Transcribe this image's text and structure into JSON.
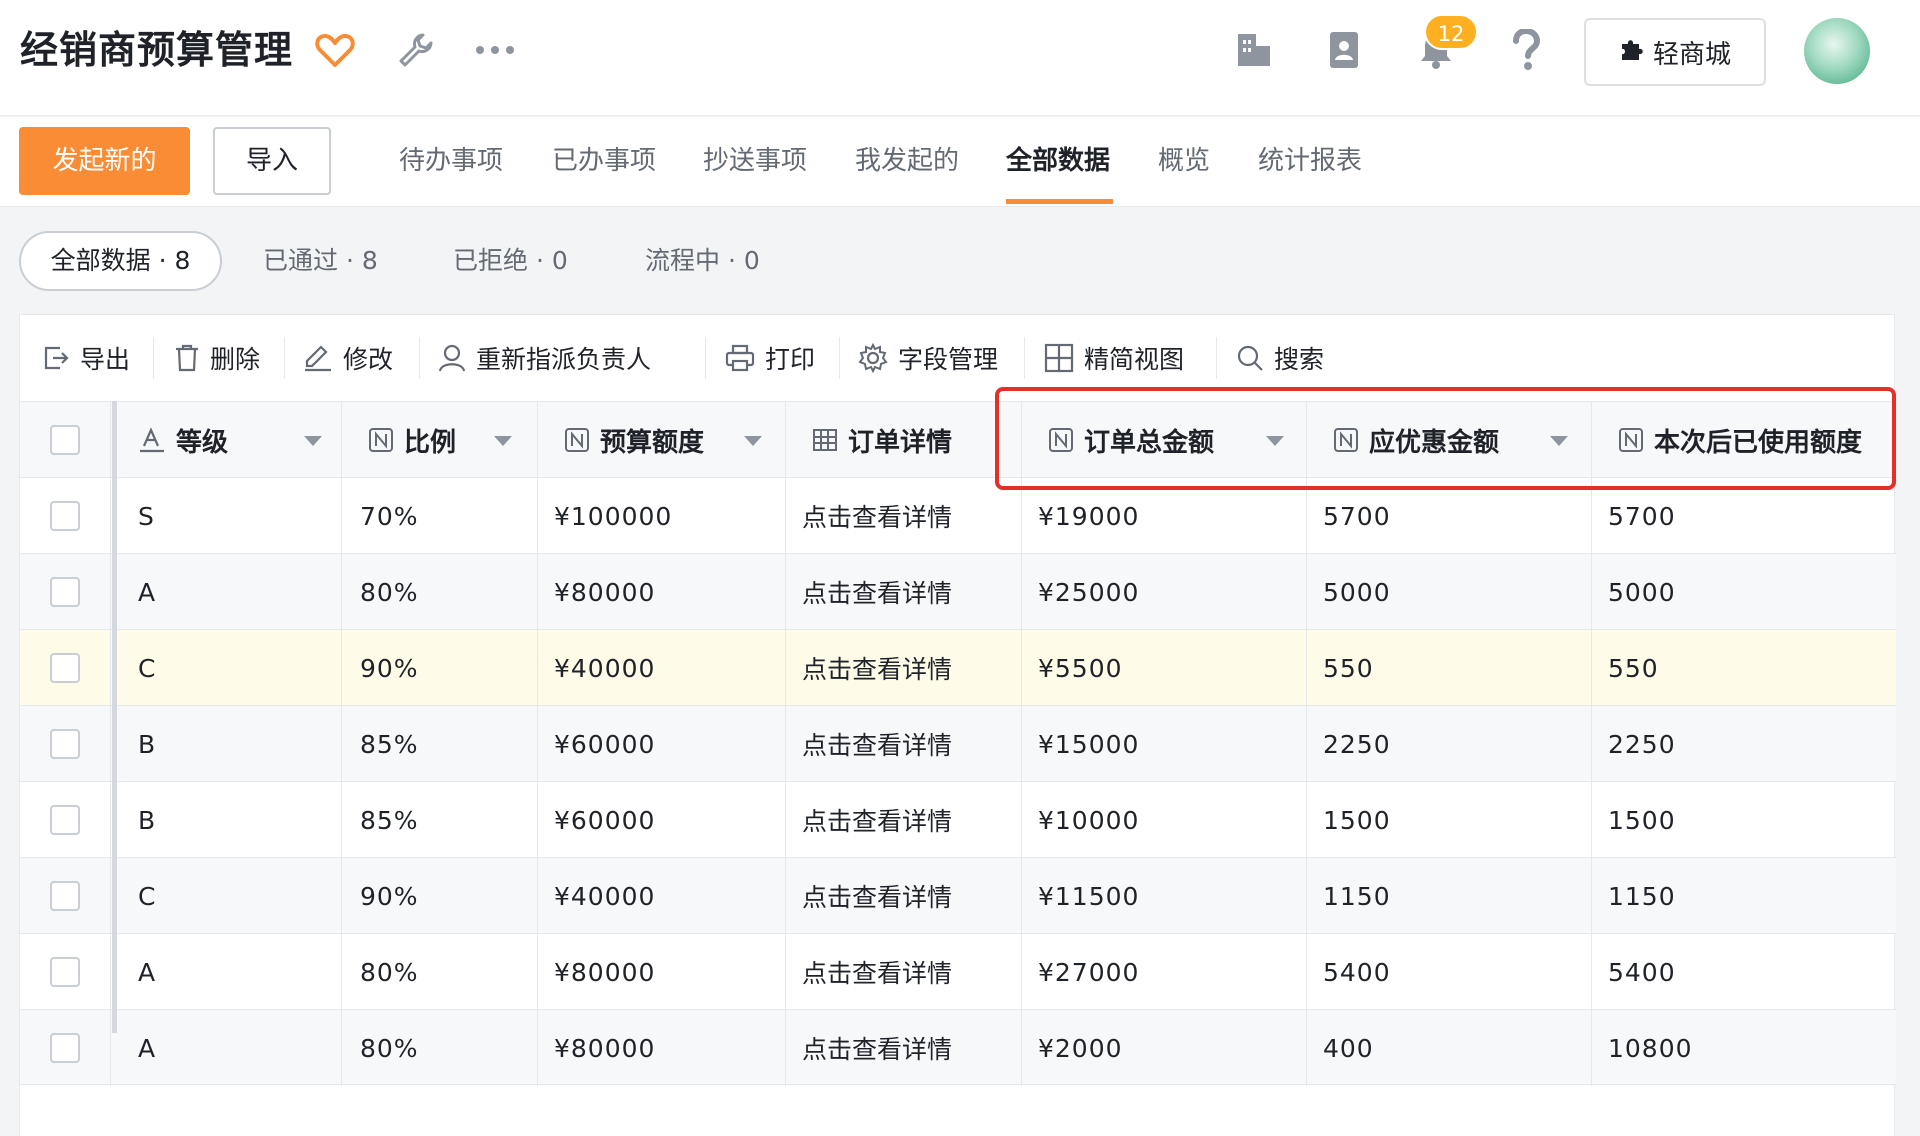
{
  "header": {
    "title": "经销商预算管理",
    "notification_count": "12",
    "store_label": "轻商城",
    "icons": [
      "heart-icon",
      "wrench-icon",
      "more-icon",
      "building-icon",
      "contacts-icon",
      "bell-icon",
      "help-icon",
      "puzzle-icon"
    ]
  },
  "tabbar": {
    "new_button": "发起新的",
    "import_button": "导入",
    "tabs": [
      "待办事项",
      "已办事项",
      "抄送事项",
      "我发起的",
      "全部数据",
      "概览",
      "统计报表"
    ],
    "active_tab": "全部数据",
    "accent_color": "#fa8c35"
  },
  "filters": {
    "all": "全部数据 · 8",
    "passed": "已通过 · 8",
    "rejected": "已拒绝 · 0",
    "in_process": "流程中 · 0"
  },
  "toolbar": {
    "export": "导出",
    "delete": "删除",
    "edit": "修改",
    "reassign": "重新指派负责人",
    "print": "打印",
    "fields": "字段管理",
    "compact_view": "精简视图",
    "search": "搜索"
  },
  "table": {
    "columns": [
      "等级",
      "比例",
      "预算额度",
      "订单详情",
      "订单总金额",
      "应优惠金额",
      "本次后已使用额度"
    ],
    "rows": [
      [
        "S",
        "70%",
        "¥100000",
        "点击查看详情",
        "¥19000",
        "5700",
        "5700"
      ],
      [
        "A",
        "80%",
        "¥80000",
        "点击查看详情",
        "¥25000",
        "5000",
        "5000"
      ],
      [
        "C",
        "90%",
        "¥40000",
        "点击查看详情",
        "¥5500",
        "550",
        "550"
      ],
      [
        "B",
        "85%",
        "¥60000",
        "点击查看详情",
        "¥15000",
        "2250",
        "2250"
      ],
      [
        "B",
        "85%",
        "¥60000",
        "点击查看详情",
        "¥10000",
        "1500",
        "1500"
      ],
      [
        "C",
        "90%",
        "¥40000",
        "点击查看详情",
        "¥11500",
        "1150",
        "1150"
      ],
      [
        "A",
        "80%",
        "¥80000",
        "点击查看详情",
        "¥27000",
        "5400",
        "5400"
      ],
      [
        "A",
        "80%",
        "¥80000",
        "点击查看详情",
        "¥2000",
        "400",
        "10800"
      ]
    ],
    "highlight_color": "#e5302a"
  }
}
